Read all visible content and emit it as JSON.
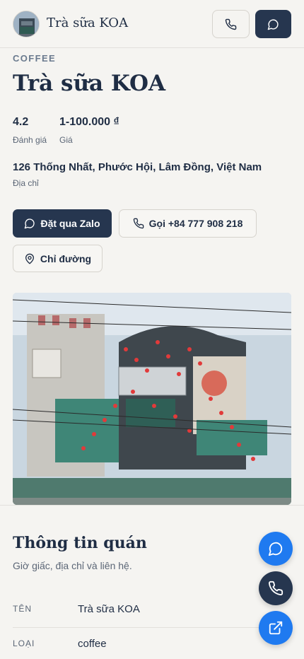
{
  "header": {
    "brand": "Trà sữa KOA",
    "avatar_icon": "shop-photo-avatar",
    "call_icon": "phone-icon",
    "chat_icon": "chat-bubble-icon"
  },
  "place": {
    "category": "COFFEE",
    "name": "Trà sữa KOA",
    "rating": "4.2",
    "rating_label": "Đánh giá",
    "price": "1-100.000 ₫",
    "price_label": "Giá",
    "address": "126 Thống Nhất, Phước Hội, Lâm Đồng, Việt Nam",
    "address_label": "Địa chỉ"
  },
  "actions": {
    "zalo": "Đặt qua Zalo",
    "call": "Gọi +84 777 908 218",
    "directions": "Chỉ đường"
  },
  "info": {
    "title": "Thông tin quán",
    "subtitle": "Giờ giấc, địa chỉ và liên hệ.",
    "rows": [
      {
        "label": "TÊN",
        "value": "Trà sữa KOA"
      },
      {
        "label": "LOẠI",
        "value": "coffee"
      }
    ]
  },
  "colors": {
    "primary": "#26364f",
    "accent_blue": "#1f7af0",
    "background": "#f5f4f1"
  }
}
